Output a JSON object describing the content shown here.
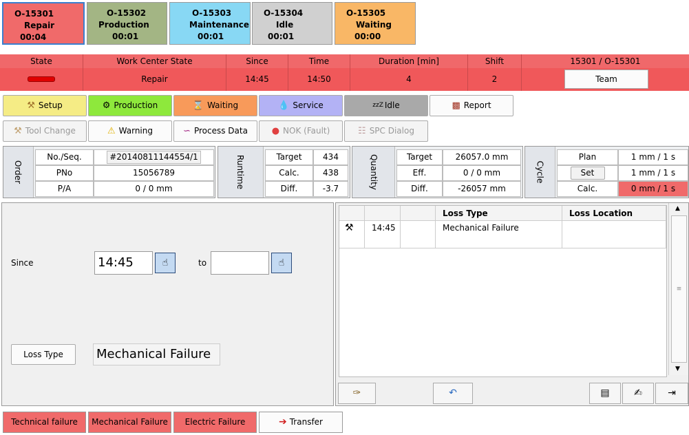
{
  "tiles": [
    {
      "code": "O-15301",
      "state": "Repair",
      "time": "00:04",
      "color": "#f06a6a"
    },
    {
      "code": "O-15302",
      "state": "Production",
      "time": "00:01",
      "color": "#a3b584"
    },
    {
      "code": "O-15303",
      "state": "Maintenance",
      "time": "00:01",
      "color": "#88d8f4"
    },
    {
      "code": "O-15304",
      "state": "Idle",
      "time": "00:01",
      "color": "#d0d0d0"
    },
    {
      "code": "O-15305",
      "state": "Waiting",
      "time": "00:00",
      "color": "#f9b766"
    }
  ],
  "status_bar": {
    "headers": {
      "state": "State",
      "wc_state": "Work Center State",
      "since": "Since",
      "time": "Time",
      "duration": "Duration [min]",
      "shift": "Shift",
      "ids": "15301  / O-15301"
    },
    "values": {
      "wc_state": "Repair",
      "since": "14:45",
      "time": "14:50",
      "duration": "4",
      "shift": "2",
      "team": "Team"
    }
  },
  "state_buttons": {
    "setup": "Setup",
    "production": "Production",
    "waiting": "Waiting",
    "service": "Service",
    "idle": "Idle",
    "idle_prefix": "zzZ",
    "report": "Report"
  },
  "tool_buttons": {
    "tool_change": "Tool Change",
    "warning": "Warning",
    "process_data": "Process Data",
    "nok": "NOK (Fault)",
    "spc": "SPC Dialog"
  },
  "order": {
    "label": "Order",
    "rows": [
      {
        "k": "No./Seq.",
        "v": "#20140811144554/1"
      },
      {
        "k": "PNo",
        "v": "15056789"
      },
      {
        "k": "P/A",
        "v": "0  / 0 mm"
      }
    ]
  },
  "runtime": {
    "label": "Runtime",
    "rows": [
      {
        "k": "Target",
        "v": "434"
      },
      {
        "k": "Calc.",
        "v": "438"
      },
      {
        "k": "Diff.",
        "v": "-3.7"
      }
    ]
  },
  "quantity": {
    "label": "Quantity",
    "rows": [
      {
        "k": "Target",
        "v": "26057.0 mm"
      },
      {
        "k": "Eff.",
        "v": "0  / 0 mm"
      },
      {
        "k": "Diff.",
        "v": "-26057 mm"
      }
    ]
  },
  "cycle": {
    "label": "Cycle",
    "rows": [
      {
        "k": "Plan",
        "v": "1 mm  / 1 s"
      },
      {
        "k": "Set",
        "v": "1 mm  / 1 s"
      },
      {
        "k": "Calc.",
        "v": "0 mm  / 1 s"
      }
    ]
  },
  "form": {
    "since_label": "Since",
    "since_value": "14:45",
    "to_label": "to",
    "to_value": "",
    "loss_type_button": "Loss Type",
    "loss_type_value": "Mechanical Failure"
  },
  "loss_table": {
    "headers": {
      "type": "Loss Type",
      "location": "Loss Location"
    },
    "rows": [
      {
        "time": "14:45",
        "type": "Mechanical Failure",
        "location": ""
      }
    ]
  },
  "quick_buttons": {
    "technical": "Technical failure",
    "mechanical": "Mechanical Failure",
    "electric": "Electric Failure",
    "transfer": "Transfer"
  }
}
